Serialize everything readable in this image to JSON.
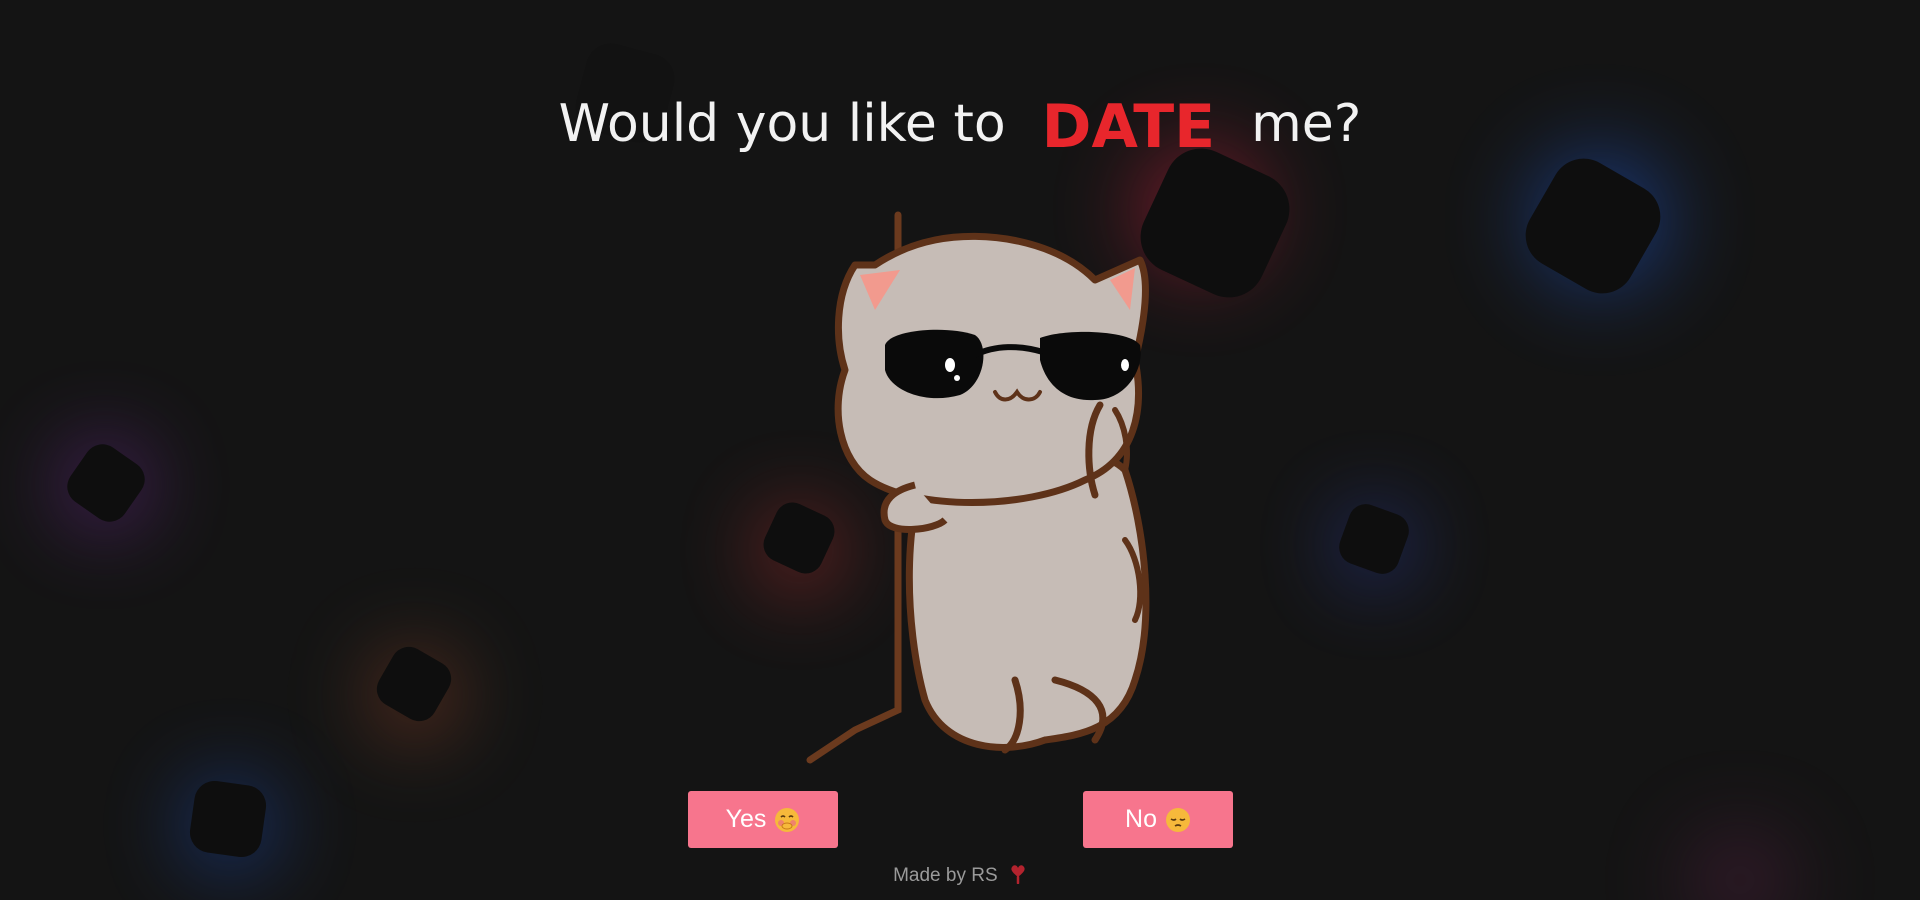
{
  "headline": {
    "prefix": "Would you like to",
    "accent": "DATE",
    "suffix": "me?"
  },
  "buttons": {
    "yes_label": "Yes",
    "yes_icon": "blushing-face-icon",
    "no_label": "No",
    "no_icon": "pensive-face-icon"
  },
  "footer": {
    "text": "Made by RS",
    "icon": "heart-icon"
  },
  "illustration": {
    "icon": "cat-with-sunglasses-illustration"
  },
  "colors": {
    "background": "#141414",
    "accent": "#e8262c",
    "button": "#f7758d",
    "text": "#f2f2f2"
  }
}
